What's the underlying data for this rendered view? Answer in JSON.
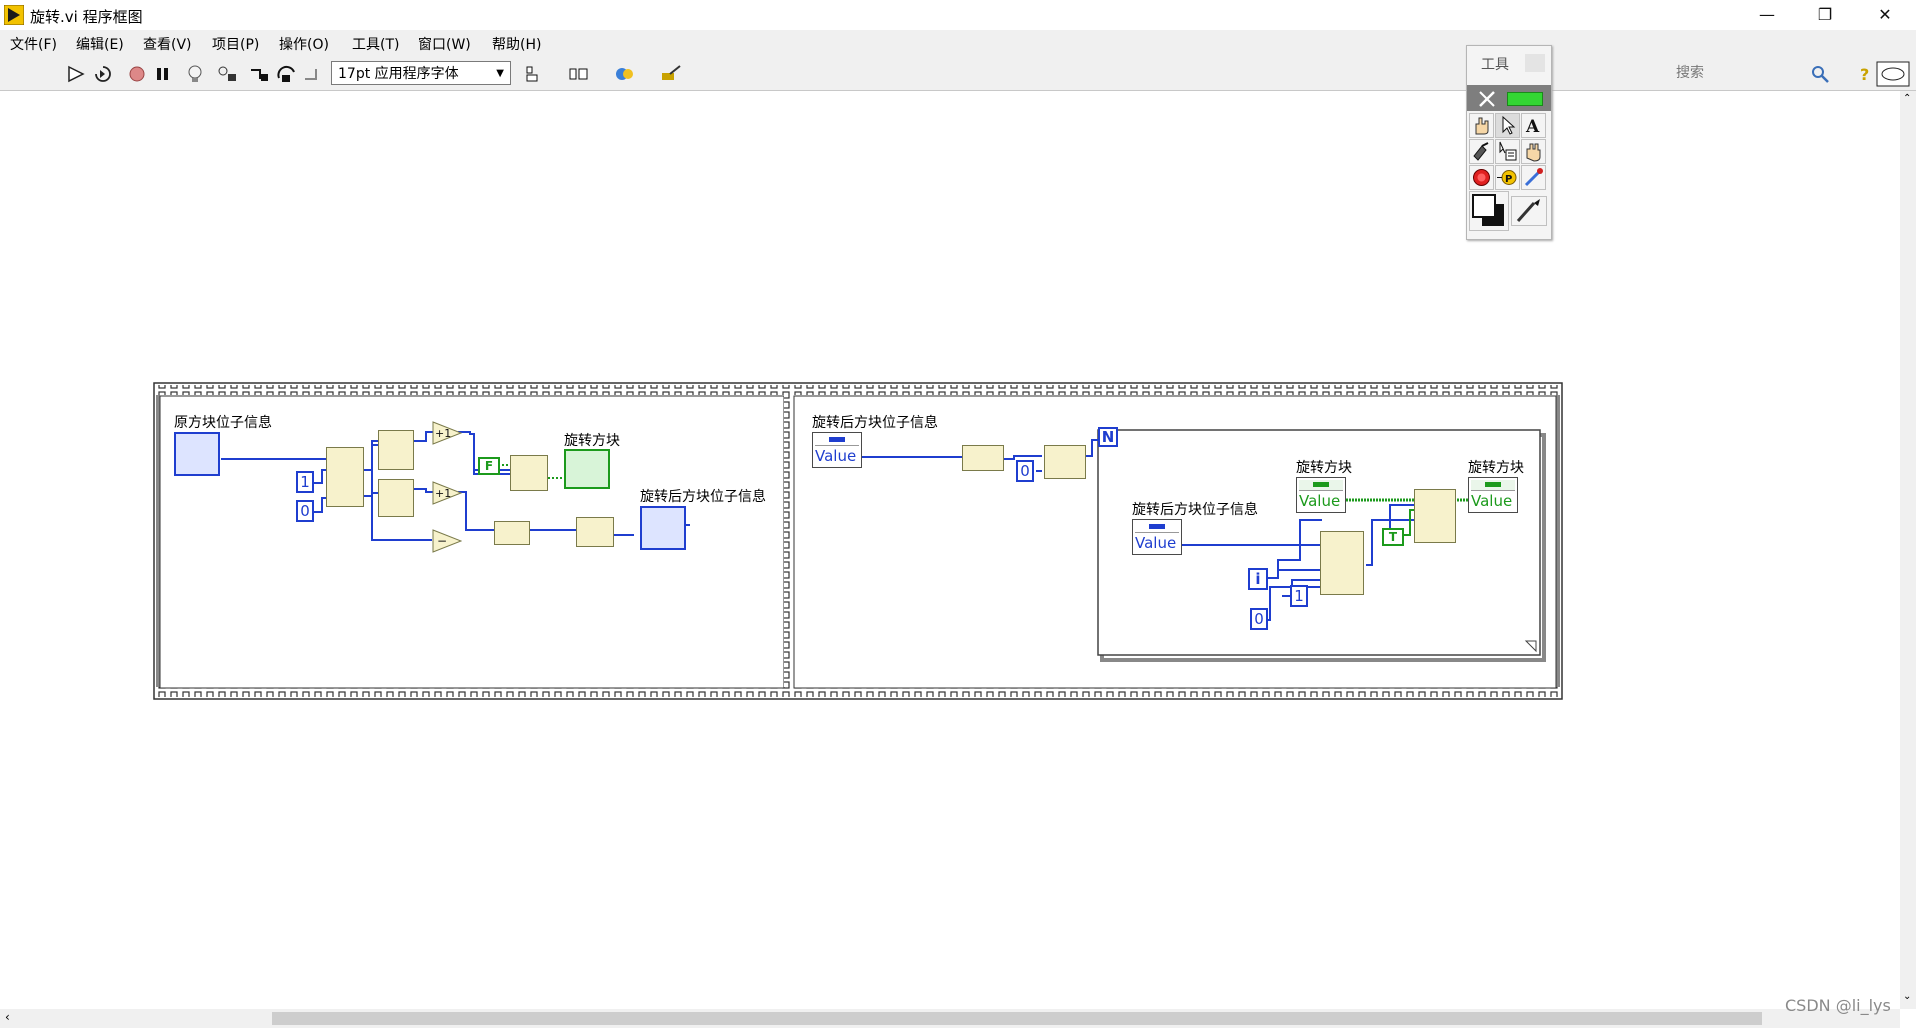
{
  "window": {
    "title": "旋转.vi 程序框图",
    "controls": {
      "minimize": "—",
      "restore": "❐",
      "close": "✕"
    }
  },
  "menu": {
    "items": [
      "文件(F)",
      "编辑(E)",
      "查看(V)",
      "项目(P)",
      "操作(O)",
      "工具(T)",
      "窗口(W)",
      "帮助(H)"
    ]
  },
  "toolbar": {
    "font": "17pt 应用程序字体",
    "search_placeholder": "搜索"
  },
  "palette": {
    "title": "工具"
  },
  "diagram": {
    "frame1": {
      "label_original": "原方块位子信息",
      "label_rotated_block": "旋转方块",
      "label_after_info": "旋转后方块位子信息",
      "const_one": "1",
      "const_zero": "0",
      "bool_false": "F",
      "inc1": "+1",
      "inc2": "+1",
      "minus": "−"
    },
    "frame2": {
      "label_after_info": "旋转后方块位子信息",
      "value_text": "Value",
      "const_zero": "0",
      "loop_count": "N",
      "loop_index": "i",
      "inner_label_after_info": "旋转后方块位子信息",
      "inner_label_rotate1": "旋转方块",
      "inner_label_rotate2": "旋转方块",
      "const_one": "1",
      "const_zero2": "0",
      "bool_true": "T"
    }
  },
  "footer": {
    "watermark": "CSDN @li_lys"
  }
}
